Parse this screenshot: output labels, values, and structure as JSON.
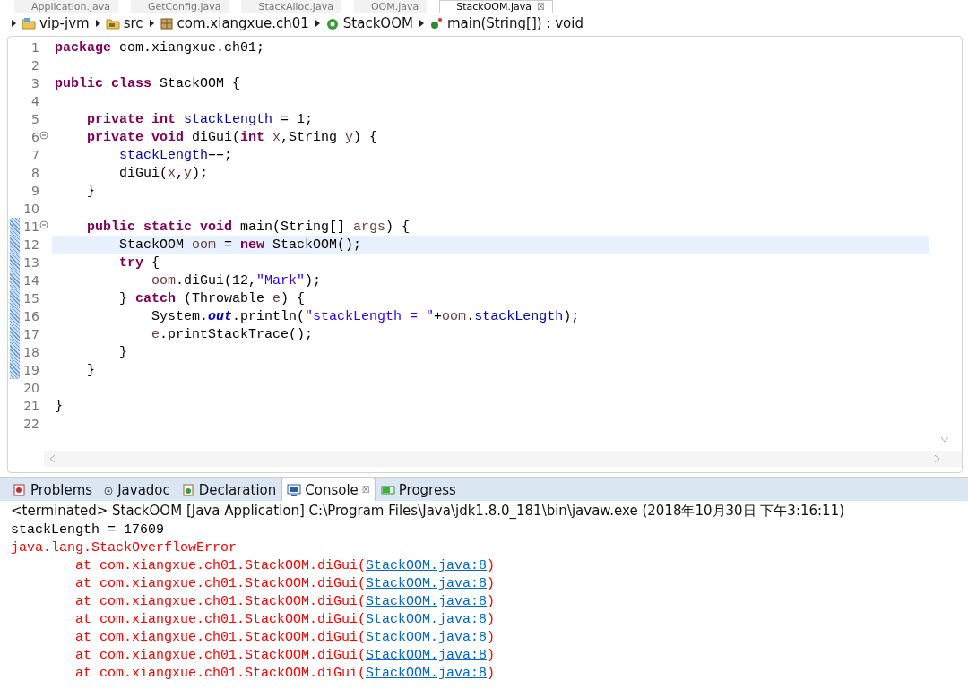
{
  "editor_tabs": [
    {
      "label": "Application.java",
      "selected": false
    },
    {
      "label": "GetConfig.java",
      "selected": false
    },
    {
      "label": "StackAlloc.java",
      "selected": false
    },
    {
      "label": "OOM.java",
      "selected": false
    },
    {
      "label": "StackOOM.java",
      "selected": true,
      "close": "☒"
    }
  ],
  "breadcrumb": [
    {
      "kind": "project",
      "label": "vip-jvm"
    },
    {
      "kind": "folder",
      "label": "src"
    },
    {
      "kind": "package",
      "label": "com.xiangxue.ch01"
    },
    {
      "kind": "class",
      "label": "StackOOM"
    },
    {
      "kind": "method",
      "label": "main(String[]) : void"
    }
  ],
  "code": [
    {
      "number": "1",
      "segments": [
        {
          "kind": "keyword",
          "text": "package"
        },
        {
          "kind": "plain",
          "text": " com.xiangxue.ch01;"
        }
      ]
    },
    {
      "number": "2"
    },
    {
      "number": "3",
      "segments": [
        {
          "kind": "keyword",
          "text": "public class"
        },
        {
          "kind": "plain",
          "text": " StackOOM {"
        }
      ]
    },
    {
      "number": "4"
    },
    {
      "number": "5",
      "segments": [
        {
          "kind": "keyword",
          "text": "    private int"
        },
        {
          "kind": "field",
          "text": " stackLength"
        },
        {
          "kind": "plain",
          "text": " = 1;"
        }
      ]
    },
    {
      "number": "6",
      "fold": true,
      "segments": [
        {
          "kind": "keyword",
          "text": "    private void"
        },
        {
          "kind": "plain",
          "text": " diGui("
        },
        {
          "kind": "keyword",
          "text": "int"
        },
        {
          "kind": "local",
          "text": " x"
        },
        {
          "kind": "plain",
          "text": ",String"
        },
        {
          "kind": "local",
          "text": " y"
        },
        {
          "kind": "plain",
          "text": ") {"
        }
      ]
    },
    {
      "number": "7",
      "segments": [
        {
          "kind": "field",
          "text": "        stackLength"
        },
        {
          "kind": "plain",
          "text": "++;"
        }
      ]
    },
    {
      "number": "8",
      "segments": [
        {
          "kind": "plain",
          "text": "        diGui("
        },
        {
          "kind": "local",
          "text": "x"
        },
        {
          "kind": "plain",
          "text": ","
        },
        {
          "kind": "local",
          "text": "y"
        },
        {
          "kind": "plain",
          "text": ");"
        }
      ]
    },
    {
      "number": "9",
      "segments": [
        {
          "kind": "plain",
          "text": "    }"
        }
      ]
    },
    {
      "number": "10"
    },
    {
      "number": "11",
      "fold": true,
      "changed": true,
      "segments": [
        {
          "kind": "keyword",
          "text": "    public static void"
        },
        {
          "kind": "plain",
          "text": " main(String[]"
        },
        {
          "kind": "local",
          "text": " args"
        },
        {
          "kind": "plain",
          "text": ") {"
        }
      ]
    },
    {
      "number": "12",
      "changed": true,
      "current": true,
      "segments": [
        {
          "kind": "plain",
          "text": "        StackOOM "
        },
        {
          "kind": "local",
          "text": "oom"
        },
        {
          "kind": "plain",
          "text": " = "
        },
        {
          "kind": "keyword",
          "text": "new"
        },
        {
          "kind": "plain",
          "text": " StackOOM();"
        }
      ]
    },
    {
      "number": "13",
      "changed": true,
      "segments": [
        {
          "kind": "keyword",
          "text": "        try"
        },
        {
          "kind": "plain",
          "text": " {"
        }
      ]
    },
    {
      "number": "14",
      "changed": true,
      "segments": [
        {
          "kind": "local",
          "text": "            oom"
        },
        {
          "kind": "plain",
          "text": ".diGui(12,"
        },
        {
          "kind": "string",
          "text": "\"Mark\""
        },
        {
          "kind": "plain",
          "text": ");"
        }
      ]
    },
    {
      "number": "15",
      "changed": true,
      "segments": [
        {
          "kind": "plain",
          "text": "        } "
        },
        {
          "kind": "keyword",
          "text": "catch"
        },
        {
          "kind": "plain",
          "text": " (Throwable "
        },
        {
          "kind": "local",
          "text": "e"
        },
        {
          "kind": "plain",
          "text": ") {"
        }
      ]
    },
    {
      "number": "16",
      "changed": true,
      "segments": [
        {
          "kind": "plain",
          "text": "            System."
        },
        {
          "kind": "static",
          "text": "out"
        },
        {
          "kind": "plain",
          "text": ".println("
        },
        {
          "kind": "string",
          "text": "\"stackLength = \""
        },
        {
          "kind": "plain",
          "text": "+"
        },
        {
          "kind": "local",
          "text": "oom"
        },
        {
          "kind": "plain",
          "text": "."
        },
        {
          "kind": "field",
          "text": "stackLength"
        },
        {
          "kind": "plain",
          "text": ");"
        }
      ]
    },
    {
      "number": "17",
      "changed": true,
      "segments": [
        {
          "kind": "local",
          "text": "            e"
        },
        {
          "kind": "plain",
          "text": ".printStackTrace();"
        }
      ]
    },
    {
      "number": "18",
      "changed": true,
      "segments": [
        {
          "kind": "plain",
          "text": "        }"
        }
      ]
    },
    {
      "number": "19",
      "changed": true,
      "segments": [
        {
          "kind": "plain",
          "text": "    }"
        }
      ]
    },
    {
      "number": "20"
    },
    {
      "number": "21",
      "segments": [
        {
          "kind": "plain",
          "text": "}"
        }
      ]
    },
    {
      "number": "22"
    }
  ],
  "panel_tabs": [
    {
      "kind": "problems",
      "label": "Problems",
      "selected": false
    },
    {
      "kind": "javadoc",
      "label": "Javadoc",
      "selected": false
    },
    {
      "kind": "declaration",
      "label": "Declaration",
      "selected": false
    },
    {
      "kind": "console",
      "label": "Console",
      "selected": true,
      "close": "☒"
    },
    {
      "kind": "progress",
      "label": "Progress",
      "selected": false
    }
  ],
  "console_header": "<terminated> StackOOM [Java Application] C:\\Program Files\\Java\\jdk1.8.0_181\\bin\\javaw.exe (2018年10月30日 下午3:16:11)",
  "console": [
    {
      "kind": "out",
      "text": "stackLength = 17609"
    },
    {
      "kind": "err",
      "text": "java.lang.StackOverflowError"
    },
    {
      "kind": "trace",
      "text": "at com.xiangxue.ch01.StackOOM.diGui(",
      "link": "StackOOM.java:8",
      "after": ")"
    },
    {
      "kind": "trace",
      "text": "at com.xiangxue.ch01.StackOOM.diGui(",
      "link": "StackOOM.java:8",
      "after": ")"
    },
    {
      "kind": "trace",
      "text": "at com.xiangxue.ch01.StackOOM.diGui(",
      "link": "StackOOM.java:8",
      "after": ")"
    },
    {
      "kind": "trace",
      "text": "at com.xiangxue.ch01.StackOOM.diGui(",
      "link": "StackOOM.java:8",
      "after": ")"
    },
    {
      "kind": "trace",
      "text": "at com.xiangxue.ch01.StackOOM.diGui(",
      "link": "StackOOM.java:8",
      "after": ")"
    },
    {
      "kind": "trace",
      "text": "at com.xiangxue.ch01.StackOOM.diGui(",
      "link": "StackOOM.java:8",
      "after": ")"
    },
    {
      "kind": "trace",
      "text": "at com.xiangxue.ch01.StackOOM.diGui(",
      "link": "StackOOM.java:8",
      "after": ")"
    }
  ]
}
